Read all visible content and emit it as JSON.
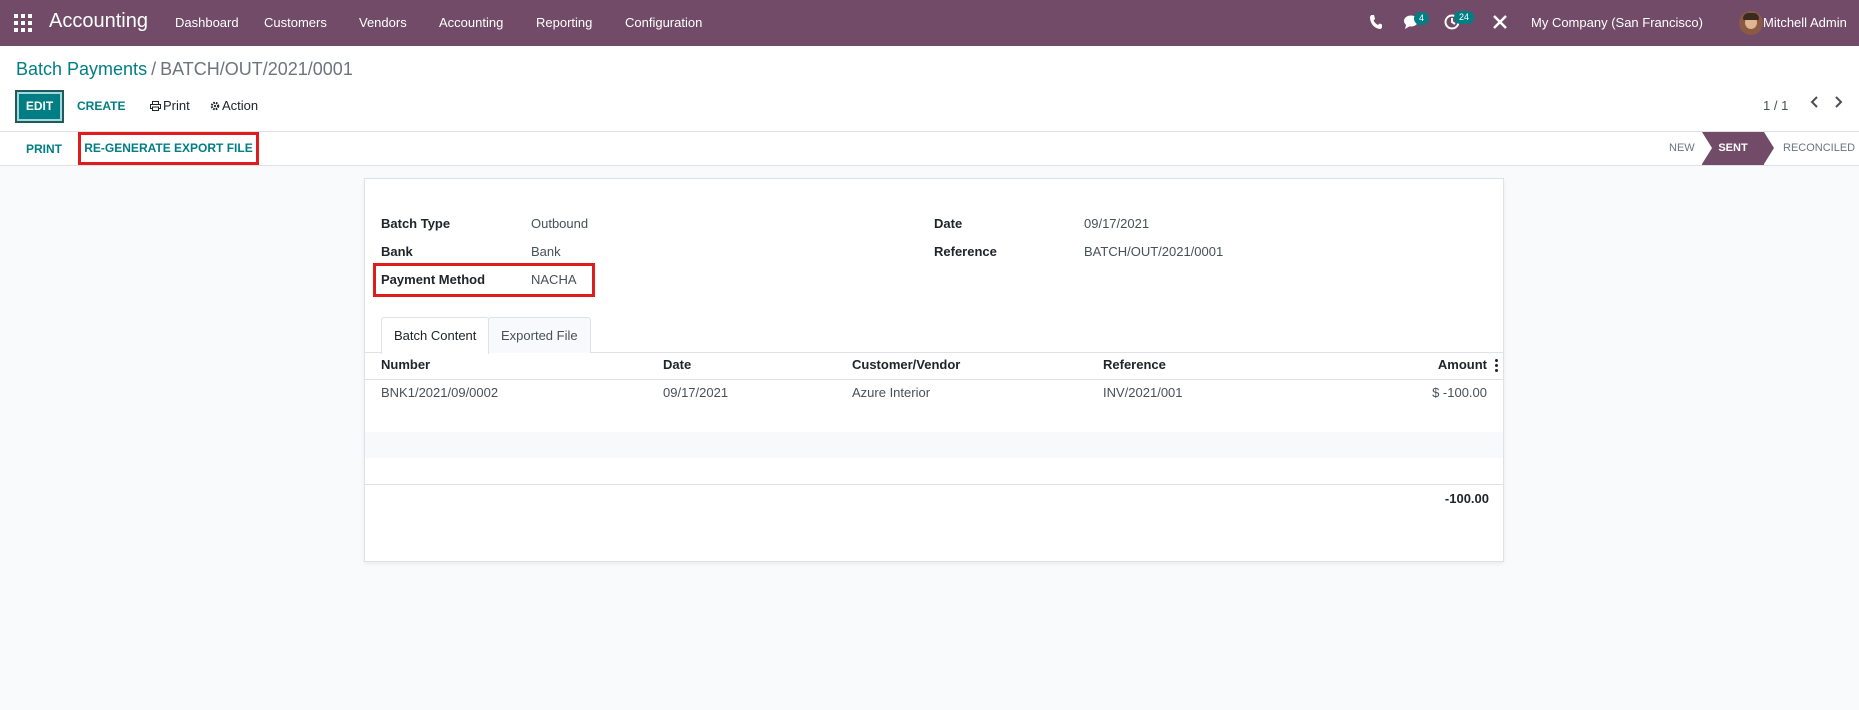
{
  "navbar": {
    "brand": "Accounting",
    "menu": [
      "Dashboard",
      "Customers",
      "Vendors",
      "Accounting",
      "Reporting",
      "Configuration"
    ],
    "messages_badge": "4",
    "activities_badge": "24",
    "company": "My Company (San Francisco)",
    "user": "Mitchell Admin",
    "icons": [
      "apps-grid-icon",
      "phone-icon",
      "chat-icon",
      "clock-icon",
      "close-icon"
    ]
  },
  "breadcrumb": {
    "parent": "Batch Payments",
    "separator": "/",
    "current": "BATCH/OUT/2021/0001"
  },
  "toolbar": {
    "edit": "EDIT",
    "create": "CREATE",
    "print": "Print",
    "action": "Action",
    "pager": "1 / 1"
  },
  "statusbar": {
    "print": "PRINT",
    "regenerate": "RE-GENERATE EXPORT FILE",
    "stages": [
      "NEW",
      "SENT",
      "RECONCILED"
    ],
    "active_stage": "SENT"
  },
  "form": {
    "batch_type_label": "Batch Type",
    "batch_type": "Outbound",
    "bank_label": "Bank",
    "bank": "Bank",
    "payment_method_label": "Payment Method",
    "payment_method": "NACHA",
    "date_label": "Date",
    "date": "09/17/2021",
    "reference_label": "Reference",
    "reference": "BATCH/OUT/2021/0001"
  },
  "tabs": [
    "Batch Content",
    "Exported File"
  ],
  "table": {
    "headers": [
      "Number",
      "Date",
      "Customer/Vendor",
      "Reference",
      "Amount"
    ],
    "rows": [
      [
        "BNK1/2021/09/0002",
        "09/17/2021",
        "Azure Interior",
        "INV/2021/001",
        "$ -100.00"
      ]
    ],
    "total": "-100.00"
  },
  "colors": {
    "brand": "#714b67",
    "accent": "#017e84",
    "highlight": "#e01b1b"
  }
}
